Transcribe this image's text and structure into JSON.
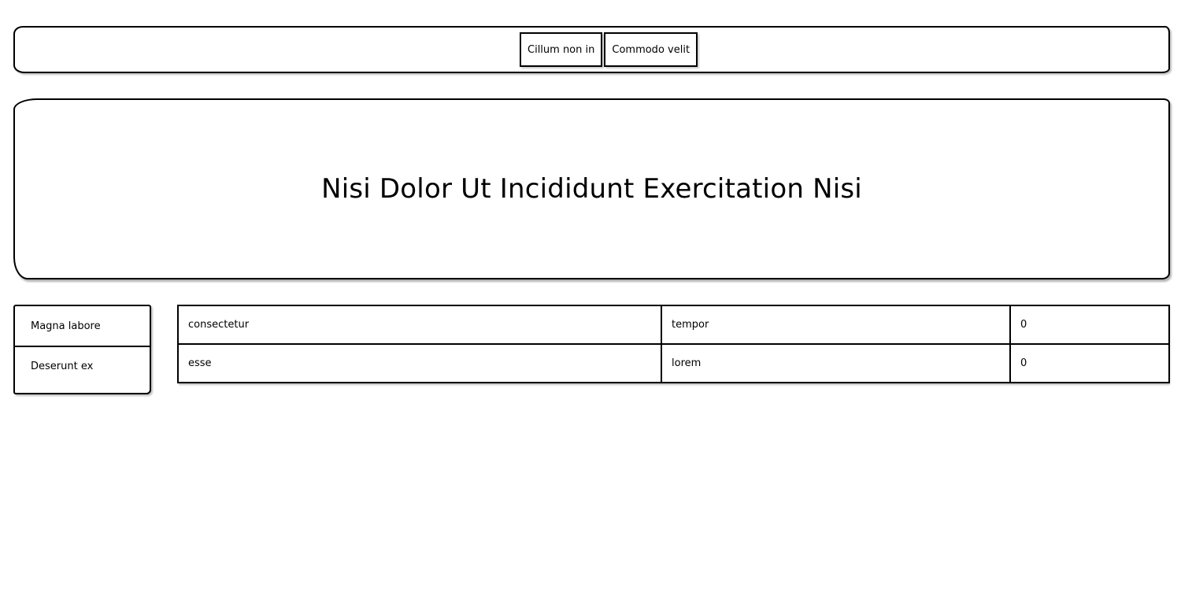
{
  "nav": {
    "items": [
      {
        "label": "Cillum non in"
      },
      {
        "label": "Commodo velit"
      }
    ]
  },
  "hero": {
    "title": "Nisi Dolor Ut Incididunt Exercitation Nisi"
  },
  "sidebar": {
    "items": [
      {
        "label": "Magna labore"
      },
      {
        "label": "Deserunt ex"
      }
    ]
  },
  "table": {
    "rows": [
      [
        "consectetur",
        "tempor",
        "0"
      ],
      [
        "esse",
        "lorem",
        "0"
      ]
    ]
  }
}
